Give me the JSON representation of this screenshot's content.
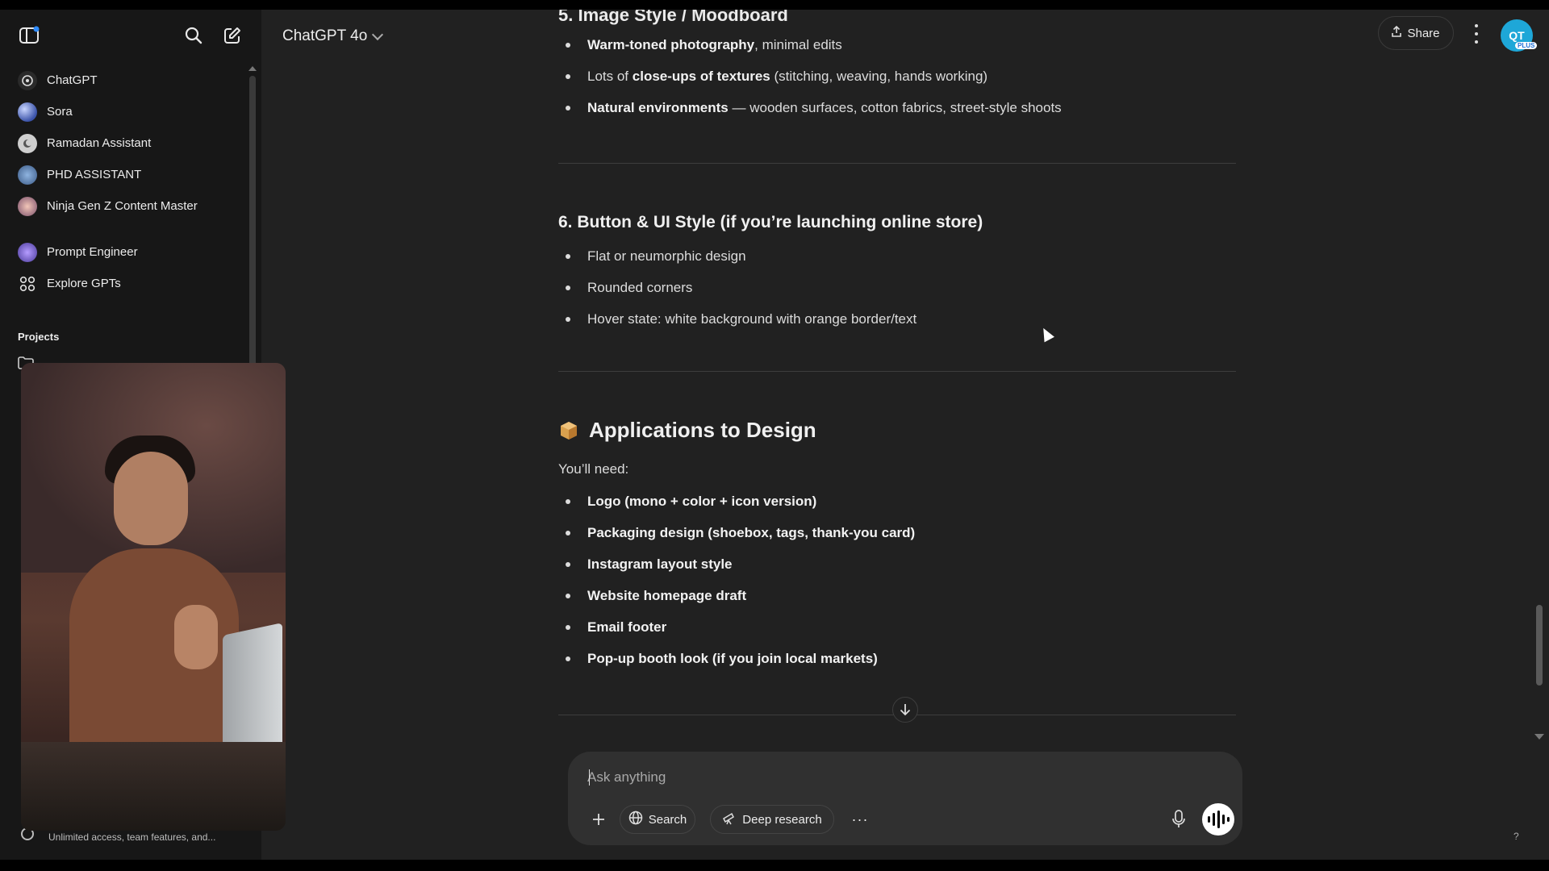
{
  "sidebar": {
    "items": [
      {
        "label": "ChatGPT",
        "icon": "openai-logo-icon"
      },
      {
        "label": "Sora",
        "icon": "sora-icon"
      },
      {
        "label": "Ramadan Assistant",
        "icon": "gpt-avatar-icon"
      },
      {
        "label": "PHD ASSISTANT",
        "icon": "gpt-avatar-icon"
      },
      {
        "label": "Ninja Gen Z Content Master",
        "icon": "gpt-avatar-icon"
      },
      {
        "label": "Prompt Engineer",
        "icon": "gpt-avatar-icon"
      },
      {
        "label": "Explore GPTs",
        "icon": "grid-icon"
      }
    ],
    "projects_heading": "Projects",
    "footer_text": "Unlimited access, team features, and..."
  },
  "header": {
    "model_label": "ChatGPT 4o",
    "share_label": "Share",
    "avatar_initials": "QT",
    "plan_badge": "PLUS"
  },
  "content": {
    "cut_heading": "5. Image Style / Moodboard",
    "section5_items": [
      {
        "bold": "Warm-toned photography",
        "rest": ", minimal edits"
      },
      {
        "pre": "Lots of ",
        "bold": "close-ups of textures",
        "rest": " (stitching, weaving, hands working)"
      },
      {
        "bold": "Natural environments",
        "rest": " — wooden surfaces, cotton fabrics, street-style shoots"
      }
    ],
    "section6_heading": "6. Button & UI Style (if you’re launching online store)",
    "section6_items": [
      "Flat or neumorphic design",
      "Rounded corners",
      "Hover state: white background with orange border/text"
    ],
    "apps_heading": "Applications to Design",
    "apps_intro": "You’ll need:",
    "apps_items": [
      "Logo (mono + color + icon version)",
      "Packaging design (shoebox, tags, thank-you card)",
      "Instagram layout style",
      "Website homepage draft",
      "Email footer",
      "Pop-up booth look (if you join local markets)"
    ]
  },
  "composer": {
    "placeholder": "Ask anything",
    "search_label": "Search",
    "deep_research_label": "Deep research"
  },
  "help_label": "?"
}
